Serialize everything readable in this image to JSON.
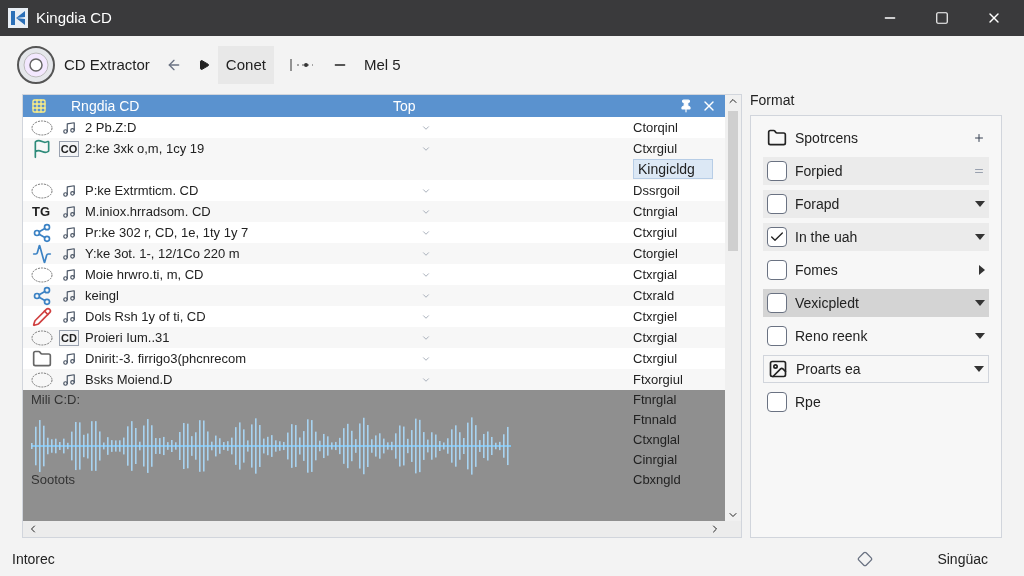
{
  "window": {
    "title": "Kingdia CD"
  },
  "toolbar": {
    "app_name": "CD Extractor",
    "button": "Conet",
    "label": "Mel 5"
  },
  "list": {
    "title": "Rngdia CD",
    "column": "Top",
    "rows": [
      {
        "kind": "disc",
        "badge": "",
        "name": "2 Pb.Z:D",
        "status": "Ctorqinl"
      },
      {
        "kind": "flag",
        "badge": "CO",
        "name": "2:ke 3xk o,m, 1cy 19",
        "status": "Ctxrgiul",
        "edit": "Kingicldg"
      },
      {
        "kind": "disc",
        "badge": "",
        "name": "P:ke Extrmticm. CD",
        "status": "Dssrgoil"
      },
      {
        "kind": "text",
        "label": "TG",
        "badge": "",
        "name": "M.iniox.hrradsom. CD",
        "status": "Ctnrgial"
      },
      {
        "kind": "nodes",
        "badge": "",
        "name": "Pr:ke 302 r, CD, 1e, 1ty 1y 7",
        "status": "Ctxrgiul"
      },
      {
        "kind": "wave",
        "badge": "",
        "name": "Y:ke 3ot. 1-, 12/1Co 220 m",
        "status": "Ctorgiel"
      },
      {
        "kind": "disc",
        "badge": "",
        "name": "Moie hrwro.ti, m, CD",
        "status": "Ctxrgial"
      },
      {
        "kind": "nodes",
        "badge": "",
        "name": "keingl",
        "status": "Ctxrald"
      },
      {
        "kind": "pencil",
        "badge": "",
        "name": "Dols Rsh 1y of ti, CD",
        "status": "Ctxrgiel"
      },
      {
        "kind": "disc",
        "badge": "CD",
        "name": "Proieri Ium..31",
        "status": "Ctxrgial"
      },
      {
        "kind": "folder",
        "badge": "",
        "name": "Dnirit:-3. firrigo3(phcnrecom",
        "status": "Ctxrgiul"
      },
      {
        "kind": "disc",
        "badge": "",
        "name": "Bsks Moiend.D",
        "status": "Ftxorgiul"
      }
    ],
    "band_rows": [
      {
        "kind": "text",
        "name": "Mili C:D:",
        "status": "Ftnrglal"
      },
      {
        "kind": "waveform",
        "status": "Ftnnald"
      },
      {
        "kind": "waveform",
        "status": "Ctxnglal"
      },
      {
        "kind": "waveform",
        "status": "Cinrgial"
      },
      {
        "kind": "text",
        "name": "Sootots",
        "status": "Cbxngld"
      }
    ]
  },
  "format": {
    "title": "Format",
    "items": [
      {
        "kind": "folder",
        "label": "Spotrcens",
        "selected": false
      },
      {
        "kind": "checkbox",
        "label": "Forpied",
        "checked": false,
        "selected": false
      },
      {
        "kind": "checkbox",
        "label": "Forapd",
        "checked": false,
        "selected": false
      },
      {
        "kind": "checkbox",
        "label": "In the uah",
        "checked": true,
        "selected": false
      },
      {
        "kind": "checkbox",
        "label": "Fomes",
        "checked": false,
        "selected": false
      },
      {
        "kind": "checkbox",
        "label": "Vexicpledt",
        "checked": false,
        "selected": true
      },
      {
        "kind": "checkbox",
        "label": "Reno reenk",
        "checked": false,
        "selected": false
      },
      {
        "kind": "image",
        "label": "Proarts ea",
        "selected": false
      },
      {
        "kind": "checkbox",
        "label": "Rpe",
        "checked": false,
        "selected": false
      }
    ]
  },
  "status_bar": {
    "left": "Intorec",
    "right": "Singüac"
  }
}
